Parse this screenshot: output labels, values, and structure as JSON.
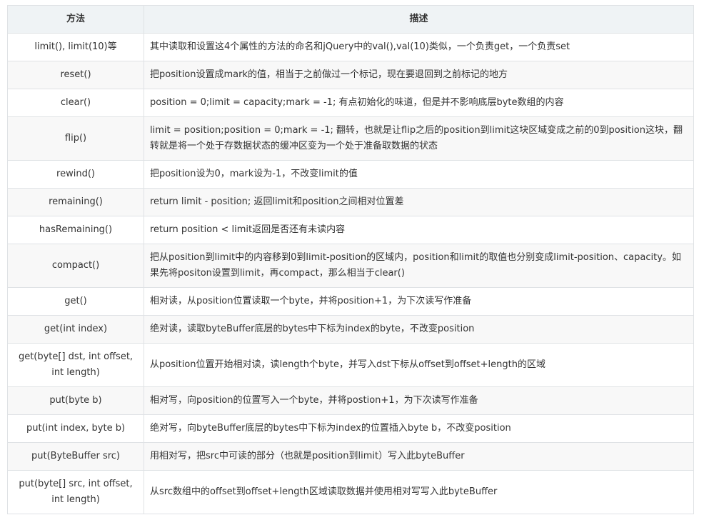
{
  "table": {
    "headers": [
      "方法",
      "描述"
    ],
    "rows": [
      {
        "method": "limit(), limit(10)等",
        "desc": "其中读取和设置这4个属性的方法的命名和jQuery中的val(),val(10)类似，一个负责get，一个负责set"
      },
      {
        "method": "reset()",
        "desc": "把position设置成mark的值，相当于之前做过一个标记，现在要退回到之前标记的地方"
      },
      {
        "method": "clear()",
        "desc": "position = 0;limit = capacity;mark = -1;  有点初始化的味道，但是并不影响底层byte数组的内容"
      },
      {
        "method": "flip()",
        "desc": "limit = position;position = 0;mark = -1;  翻转，也就是让flip之后的position到limit这块区域变成之前的0到position这块，翻转就是将一个处于存数据状态的缓冲区变为一个处于准备取数据的状态"
      },
      {
        "method": "rewind()",
        "desc": "把position设为0，mark设为-1，不改变limit的值"
      },
      {
        "method": "remaining()",
        "desc": "return limit - position; 返回limit和position之间相对位置差"
      },
      {
        "method": "hasRemaining()",
        "desc": "return position < limit返回是否还有未读内容"
      },
      {
        "method": "compact()",
        "desc": "把从position到limit中的内容移到0到limit-position的区域内，position和limit的取值也分别变成limit-position、capacity。如果先将positon设置到limit，再compact，那么相当于clear()"
      },
      {
        "method": "get()",
        "desc": "相对读，从position位置读取一个byte，并将position+1，为下次读写作准备"
      },
      {
        "method": "get(int index)",
        "desc": "绝对读，读取byteBuffer底层的bytes中下标为index的byte，不改变position"
      },
      {
        "method": "get(byte[] dst, int offset, int length)",
        "desc": "从position位置开始相对读，读length个byte，并写入dst下标从offset到offset+length的区域"
      },
      {
        "method": "put(byte b)",
        "desc": "相对写，向position的位置写入一个byte，并将postion+1，为下次读写作准备"
      },
      {
        "method": "put(int index, byte b)",
        "desc": "绝对写，向byteBuffer底层的bytes中下标为index的位置插入byte b，不改变position"
      },
      {
        "method": "put(ByteBuffer src)",
        "desc": "用相对写，把src中可读的部分（也就是position到limit）写入此byteBuffer"
      },
      {
        "method": "put(byte[] src, int offset, int length)",
        "desc": "从src数组中的offset到offset+length区域读取数据并使用相对写写入此byteBuffer"
      }
    ]
  }
}
